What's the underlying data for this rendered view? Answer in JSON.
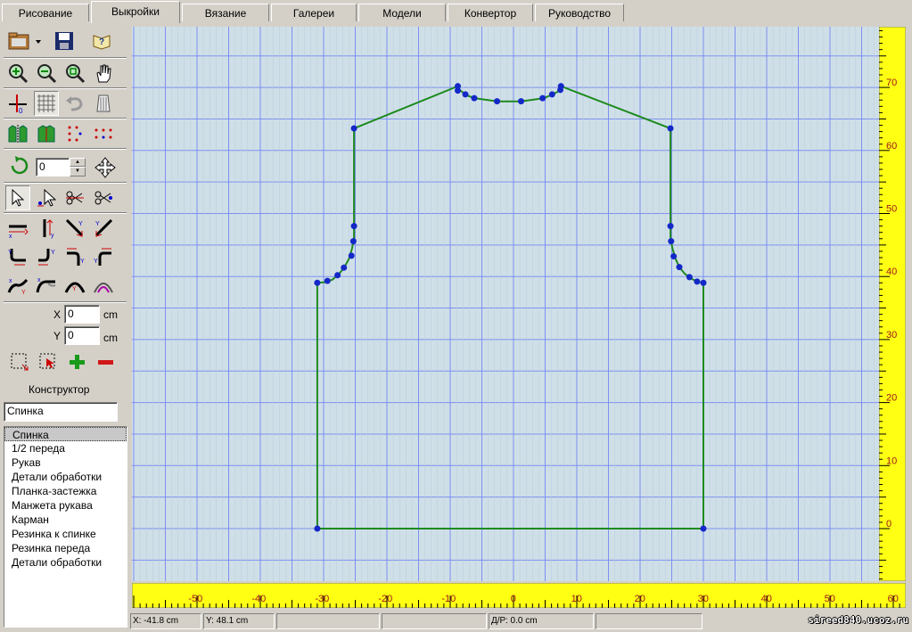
{
  "tabs": [
    "Рисование",
    "Выкройки",
    "Вязание",
    "Галереи",
    "Модели",
    "Конвертор",
    "Руководство"
  ],
  "active_tab": "Выкройки",
  "rotation_value": "0",
  "coord_x_label": "X",
  "coord_x_value": "0",
  "coord_x_unit": "cm",
  "coord_y_label": "Y",
  "coord_y_value": "0",
  "coord_y_unit": "cm",
  "constructor_label": "Конструктор",
  "pattern_name_value": "Спинка",
  "pattern_list": [
    "Спинка",
    "1/2 переда",
    "Рукав",
    "Детали обработки",
    "Планка-застежка",
    "Манжета рукава",
    "Карман",
    "Резинка к спинке",
    "Резинка переда",
    "Детали обработки"
  ],
  "selected_pattern_index": 0,
  "ruler": {
    "x_ticks": [
      "-50",
      "-40",
      "-30",
      "-20",
      "-10",
      "0",
      "10",
      "20",
      "30",
      "40",
      "50",
      "60"
    ],
    "y_ticks": [
      "0",
      "10",
      "20",
      "30",
      "40",
      "50",
      "60",
      "70"
    ]
  },
  "status": {
    "x": "X: -41.8 cm",
    "y": "Y: 48.1 cm",
    "dr": "Д/Р: 0.0 cm"
  },
  "watermark": "sireed840.ucoz.ru",
  "colors": {
    "grid_bg": "#cfdfe8",
    "grid_line": "#7d8ff0",
    "outline": "#1e8a1e",
    "points": "#1428c8",
    "ruler": "#ffff14"
  },
  "pattern_outline_cm": [
    [
      -31,
      0
    ],
    [
      30,
      0
    ],
    [
      30,
      39
    ],
    [
      29,
      39.2
    ],
    [
      28,
      39.7
    ],
    [
      27,
      40.5
    ],
    [
      26.2,
      41.5
    ],
    [
      25.6,
      42.8
    ],
    [
      25.1,
      44.5
    ],
    [
      24.8,
      46.2
    ],
    [
      24.8,
      48
    ],
    [
      24.8,
      63.5
    ],
    [
      7.5,
      70.2
    ],
    [
      7.5,
      69.6
    ],
    [
      6.2,
      68.9
    ],
    [
      4.8,
      68.3
    ],
    [
      1.2,
      67.8
    ],
    [
      -2.5,
      67.8
    ],
    [
      -6.2,
      68.3
    ],
    [
      -7.5,
      68.8
    ],
    [
      -8.5,
      69.6
    ],
    [
      -8.8,
      70.2
    ],
    [
      -25.2,
      63.5
    ],
    [
      -25.2,
      48
    ],
    [
      -25.2,
      46.2
    ],
    [
      -25.5,
      44.5
    ],
    [
      -26,
      42.8
    ],
    [
      -26.7,
      41.5
    ],
    [
      -27.5,
      40.5
    ],
    [
      -28.6,
      39.5
    ],
    [
      -29.8,
      39.1
    ],
    [
      -31,
      39
    ],
    [
      -31,
      0
    ]
  ],
  "pattern_points_cm": [
    [
      -31,
      0
    ],
    [
      30,
      0
    ],
    [
      30,
      39
    ],
    [
      29,
      39.2
    ],
    [
      27.8,
      39.9
    ],
    [
      26.2,
      41.5
    ],
    [
      25.3,
      43.2
    ],
    [
      24.9,
      45.6
    ],
    [
      24.8,
      48
    ],
    [
      24.8,
      63.5
    ],
    [
      7.5,
      70.2
    ],
    [
      7.4,
      69.6
    ],
    [
      6.1,
      68.9
    ],
    [
      4.6,
      68.3
    ],
    [
      1.2,
      67.8
    ],
    [
      -2.6,
      67.8
    ],
    [
      -6.2,
      68.3
    ],
    [
      -7.6,
      68.9
    ],
    [
      -8.8,
      69.5
    ],
    [
      -8.8,
      70.2
    ],
    [
      -25.2,
      63.5
    ],
    [
      -25.2,
      48
    ],
    [
      -25.3,
      45.6
    ],
    [
      -25.6,
      43.3
    ],
    [
      -26.8,
      41.4
    ],
    [
      -27.8,
      40.2
    ],
    [
      -29.4,
      39.3
    ],
    [
      -31,
      39
    ]
  ]
}
